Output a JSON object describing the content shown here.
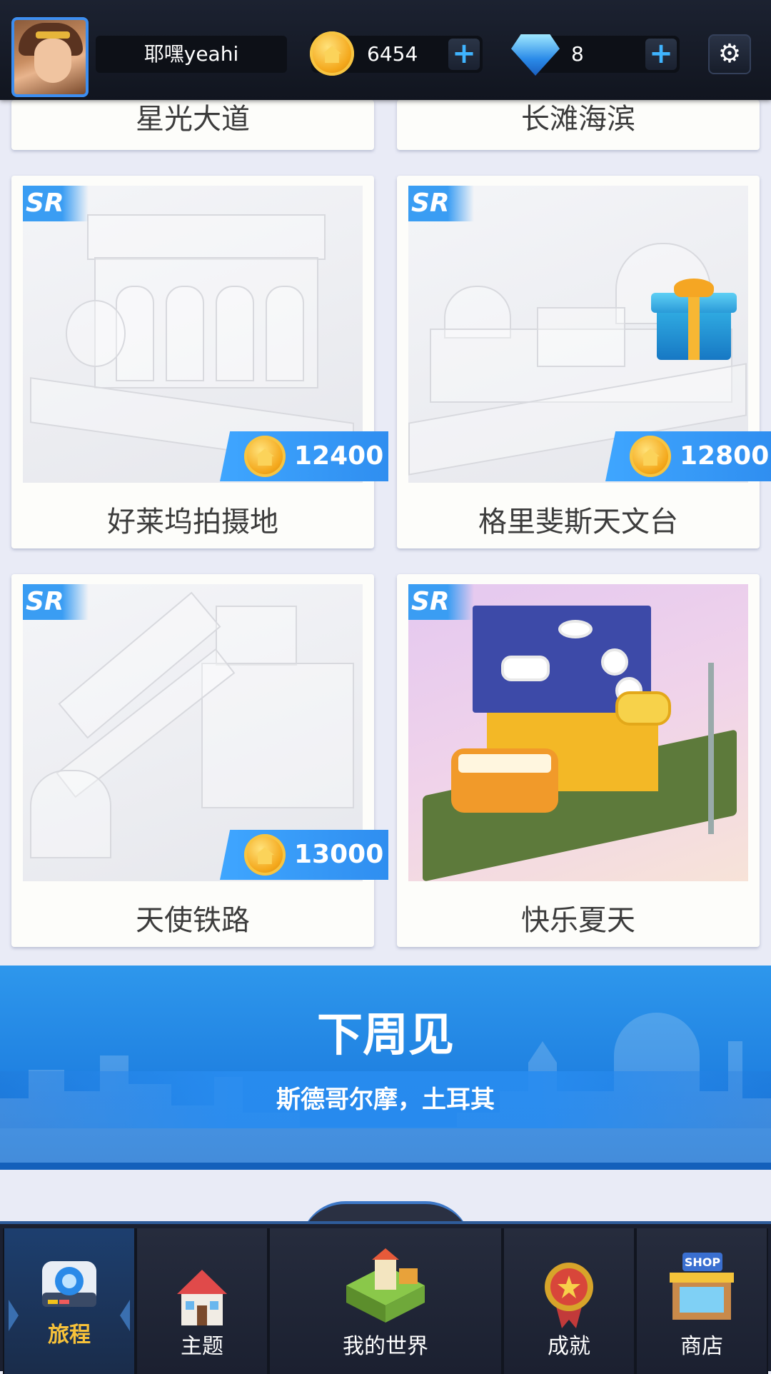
{
  "header": {
    "username": "耶嘿yeahi",
    "coins": "6454",
    "gems": "8",
    "plus": "+"
  },
  "cards_top": [
    {
      "title": "星光大道"
    },
    {
      "title": "长滩海滨"
    }
  ],
  "cards": [
    {
      "badge": "SR",
      "title": "好莱坞拍摄地",
      "price": "12400"
    },
    {
      "badge": "SR",
      "title": "格里斐斯天文台",
      "price": "12800"
    },
    {
      "badge": "SR",
      "title": "天使铁路",
      "price": "13000"
    },
    {
      "badge": "SR",
      "title": "快乐夏天"
    }
  ],
  "banner": {
    "title": "下周见",
    "subtitle": "斯德哥尔摩，土耳其"
  },
  "nav": {
    "tabs": [
      {
        "label": "旅程",
        "active": true
      },
      {
        "label": "主题"
      },
      {
        "label": "我的世界"
      },
      {
        "label": "成就"
      },
      {
        "label": "商店"
      }
    ]
  },
  "colors": {
    "accent": "#2f8ef0",
    "active_tab_label": "#f7c23a",
    "page_bg": "#e9ebf6"
  },
  "icons": [
    "gear-icon",
    "gem-icon",
    "coin-icon",
    "gift-icon",
    "camera-icon",
    "house-icon",
    "world-icon",
    "medal-icon",
    "shop-icon"
  ]
}
